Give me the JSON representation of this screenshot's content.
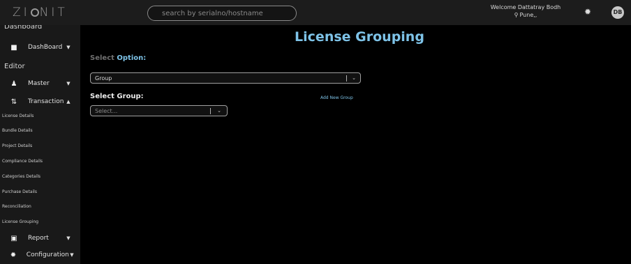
{
  "topbar": {
    "logo_left": "ZI",
    "logo_right": "NIT",
    "search_placeholder": "search by serialno/hostname",
    "welcome": "Welcome Dattatray Bodh",
    "location": "Pune,,",
    "avatar_initials": "DB"
  },
  "sidebar": {
    "section_dashboard": "Dashboard",
    "dashboard_item": "DashBoard",
    "section_editor": "Editor",
    "master_item": "Master",
    "transaction_item": "Transaction",
    "links": [
      "License Details",
      "Bundle Details",
      "Project Details",
      "Compliance Details",
      "Categories Details",
      "Purchase Details",
      "Reconciliation",
      "License Grouping"
    ],
    "report_item": "Report",
    "configuration_item": "Configuration"
  },
  "main": {
    "title": "License Grouping",
    "select_option_prefix": "Select",
    "select_option_accent": "Option:",
    "option_value": "Group",
    "select_group_label": "Select Group:",
    "add_new_group": "Add New Group",
    "group_placeholder": "Select..."
  },
  "colors": {
    "accent": "#7ec3e8",
    "background": "#000000",
    "sidebar": "#191919",
    "topbar": "#1c1c1c"
  }
}
